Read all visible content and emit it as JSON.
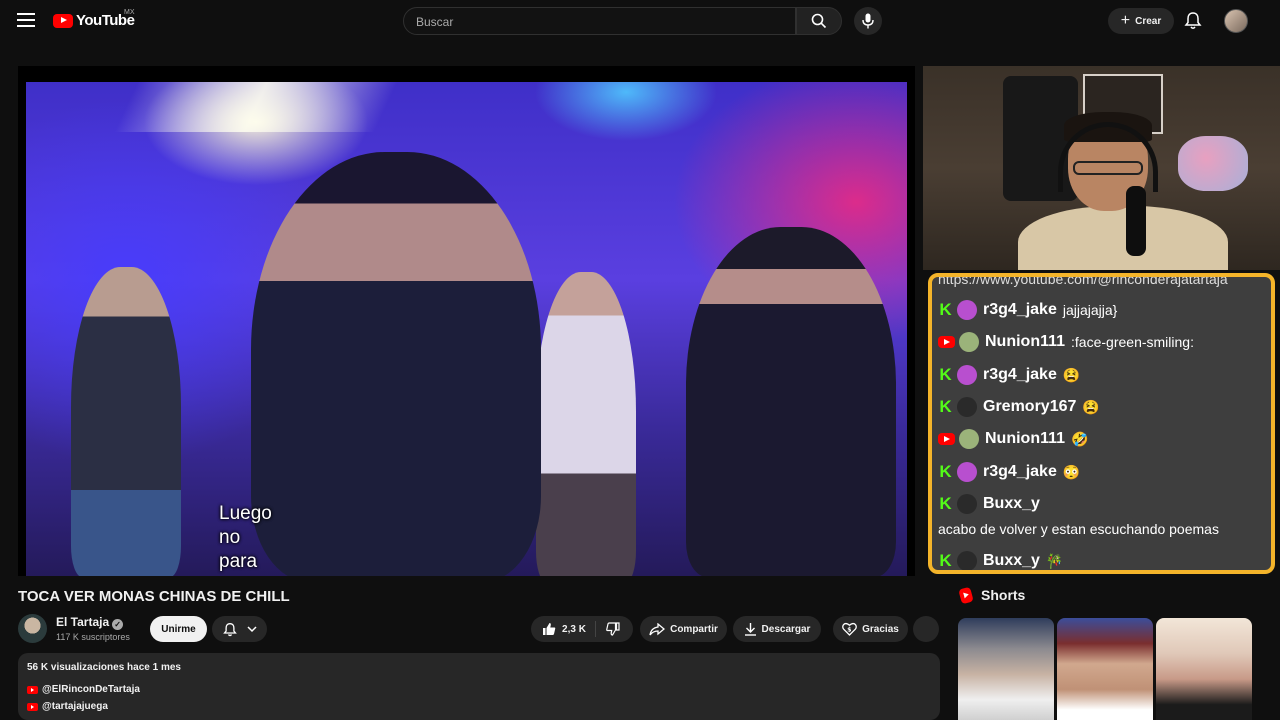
{
  "header": {
    "logo_text": "YouTube",
    "country_code": "MX",
    "search_placeholder": "Buscar",
    "create_label": "Crear"
  },
  "video": {
    "caption_lines": [
      "Luego",
      "no",
      "para"
    ]
  },
  "chat": {
    "cut_line": "https://www.youtube.com/@rinconderajatartaja",
    "messages": [
      {
        "platform": "kick",
        "user": "r3g4_jake",
        "text": "jajjajajja}",
        "avatar_color": "#b84fcf"
      },
      {
        "platform": "youtube",
        "user": "Nunion111",
        "text": ":face-green-smiling:",
        "avatar_color": "#9bb37a"
      },
      {
        "platform": "kick",
        "user": "r3g4_jake",
        "text": "😫",
        "avatar_color": "#b84fcf"
      },
      {
        "platform": "kick",
        "user": "Gremory167",
        "text": "😫",
        "avatar_color": "#2a2a2a"
      },
      {
        "platform": "youtube",
        "user": "Nunion111",
        "text": "🤣",
        "avatar_color": "#9bb37a"
      },
      {
        "platform": "kick",
        "user": "r3g4_jake",
        "text": "😳",
        "avatar_color": "#b84fcf"
      },
      {
        "platform": "kick",
        "user": "Buxx_y",
        "text": "",
        "avatar_color": "#2a2a2a"
      },
      {
        "platform": "kick",
        "user": "Buxx_y",
        "text": "🎋",
        "avatar_color": "#2a2a2a"
      }
    ],
    "free_text": "acabo de volver y estan escuchando poemas",
    "border_color": "#f4b42a"
  },
  "meta": {
    "title": "TOCA VER MONAS CHINAS DE CHILL",
    "channel_name": "El Tartaja",
    "subscribers": "117 K suscriptores",
    "join_label": "Unirme",
    "likes": "2,3 K",
    "share_label": "Compartir",
    "download_label": "Descargar",
    "thanks_label": "Gracias"
  },
  "description": {
    "stats": "56 K visualizaciones  hace 1 mes",
    "links": [
      "@ElRinconDeTartaja",
      "@tartajajuega"
    ]
  },
  "shorts": {
    "title": "Shorts"
  }
}
